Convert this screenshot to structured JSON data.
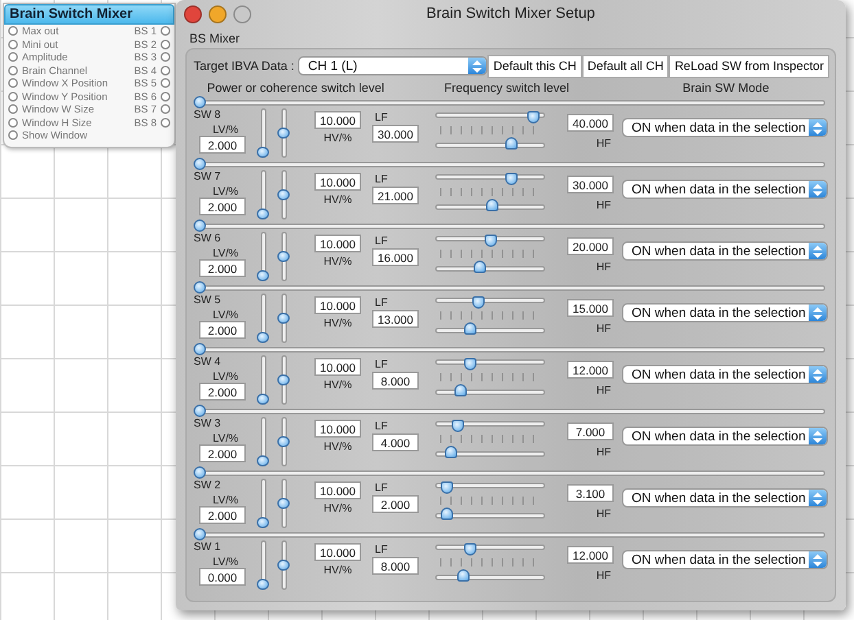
{
  "palette": {
    "title": "Brain Switch Mixer",
    "items": [
      {
        "label": "Max out",
        "port": "BS 1"
      },
      {
        "label": "Mini out",
        "port": "BS 2"
      },
      {
        "label": "Amplitude",
        "port": "BS 3"
      },
      {
        "label": "Brain Channel",
        "port": "BS 4"
      },
      {
        "label": "Window X Position",
        "port": "BS 5"
      },
      {
        "label": "Window Y Position",
        "port": "BS 6"
      },
      {
        "label": "Window W Size",
        "port": "BS 7"
      },
      {
        "label": "Window H Size",
        "port": "BS 8"
      },
      {
        "label": "Show Window"
      }
    ]
  },
  "window": {
    "title": "Brain Switch Mixer Setup"
  },
  "group_title": "BS Mixer",
  "target": {
    "label": "Target IBVA Data :",
    "value": "CH 1 (L)"
  },
  "buttons": [
    "Default this CH",
    "Default all CH",
    "ReLoad SW from Inspector"
  ],
  "headers": [
    "Power or coherence switch level",
    "Frequency switch level",
    "Brain SW Mode"
  ],
  "switches": [
    {
      "name": "SW 8",
      "power_slider": {
        "level": 0
      },
      "lv_label": "LV/%",
      "lv": "2.000",
      "lv_slider": {
        "level": 0
      },
      "hv_slider": {
        "level": 0.5
      },
      "hv": "10.000",
      "hv_label": "HV/%",
      "lf_label": "LF",
      "lf": "30.000",
      "hf_slider": {
        "level": 0.95
      },
      "lf_slider": {
        "level": 0.72
      },
      "hf": "40.000",
      "hf_label": "HF",
      "mode": "ON when data in the selection"
    },
    {
      "name": "SW 7",
      "power_slider": {
        "level": 0
      },
      "lv_label": "LV/%",
      "lv": "2.000",
      "lv_slider": {
        "level": 0
      },
      "hv_slider": {
        "level": 0.5
      },
      "hv": "10.000",
      "hv_label": "HV/%",
      "lf_label": "LF",
      "lf": "21.000",
      "hf_slider": {
        "level": 0.72
      },
      "lf_slider": {
        "level": 0.52
      },
      "hf": "30.000",
      "hf_label": "HF",
      "mode": "ON when data in the selection"
    },
    {
      "name": "SW 6",
      "power_slider": {
        "level": 0
      },
      "lv_label": "LV/%",
      "lv": "2.000",
      "lv_slider": {
        "level": 0
      },
      "hv_slider": {
        "level": 0.5
      },
      "hv": "10.000",
      "hv_label": "HV/%",
      "lf_label": "LF",
      "lf": "16.000",
      "hf_slider": {
        "level": 0.5
      },
      "lf_slider": {
        "level": 0.4
      },
      "hf": "20.000",
      "hf_label": "HF",
      "mode": "ON when data in the selection"
    },
    {
      "name": "SW 5",
      "power_slider": {
        "level": 0
      },
      "lv_label": "LV/%",
      "lv": "2.000",
      "lv_slider": {
        "level": 0
      },
      "hv_slider": {
        "level": 0.5
      },
      "hv": "10.000",
      "hv_label": "HV/%",
      "lf_label": "LF",
      "lf": "13.000",
      "hf_slider": {
        "level": 0.38
      },
      "lf_slider": {
        "level": 0.3
      },
      "hf": "15.000",
      "hf_label": "HF",
      "mode": "ON when data in the selection"
    },
    {
      "name": "SW 4",
      "power_slider": {
        "level": 0
      },
      "lv_label": "LV/%",
      "lv": "2.000",
      "lv_slider": {
        "level": 0
      },
      "hv_slider": {
        "level": 0.5
      },
      "hv": "10.000",
      "hv_label": "HV/%",
      "lf_label": "LF",
      "lf": "8.000",
      "hf_slider": {
        "level": 0.3
      },
      "lf_slider": {
        "level": 0.2
      },
      "hf": "12.000",
      "hf_label": "HF",
      "mode": "ON when data in the selection"
    },
    {
      "name": "SW 3",
      "power_slider": {
        "level": 0
      },
      "lv_label": "LV/%",
      "lv": "2.000",
      "lv_slider": {
        "level": 0
      },
      "hv_slider": {
        "level": 0.5
      },
      "hv": "10.000",
      "hv_label": "HV/%",
      "lf_label": "LF",
      "lf": "4.000",
      "hf_slider": {
        "level": 0.17
      },
      "lf_slider": {
        "level": 0.1
      },
      "hf": "7.000",
      "hf_label": "HF",
      "mode": "ON when data in the selection"
    },
    {
      "name": "SW 2",
      "power_slider": {
        "level": 0
      },
      "lv_label": "LV/%",
      "lv": "2.000",
      "lv_slider": {
        "level": 0
      },
      "hv_slider": {
        "level": 0.5
      },
      "hv": "10.000",
      "hv_label": "HV/%",
      "lf_label": "LF",
      "lf": "2.000",
      "hf_slider": {
        "level": 0.06
      },
      "lf_slider": {
        "level": 0.05
      },
      "hf": "3.100",
      "hf_label": "HF",
      "mode": "ON when data in the selection"
    },
    {
      "name": "SW 1",
      "power_slider": {
        "level": 0
      },
      "lv_label": "LV/%",
      "lv": "0.000",
      "lv_slider": {
        "level": 0
      },
      "hv_slider": {
        "level": 0.5
      },
      "hv": "10.000",
      "hv_label": "HV/%",
      "lf_label": "LF",
      "lf": "8.000",
      "hf_slider": {
        "level": 0.3
      },
      "lf_slider": {
        "level": 0.22
      },
      "hf": "12.000",
      "hf_label": "HF",
      "mode": "ON when data in the selection"
    }
  ]
}
